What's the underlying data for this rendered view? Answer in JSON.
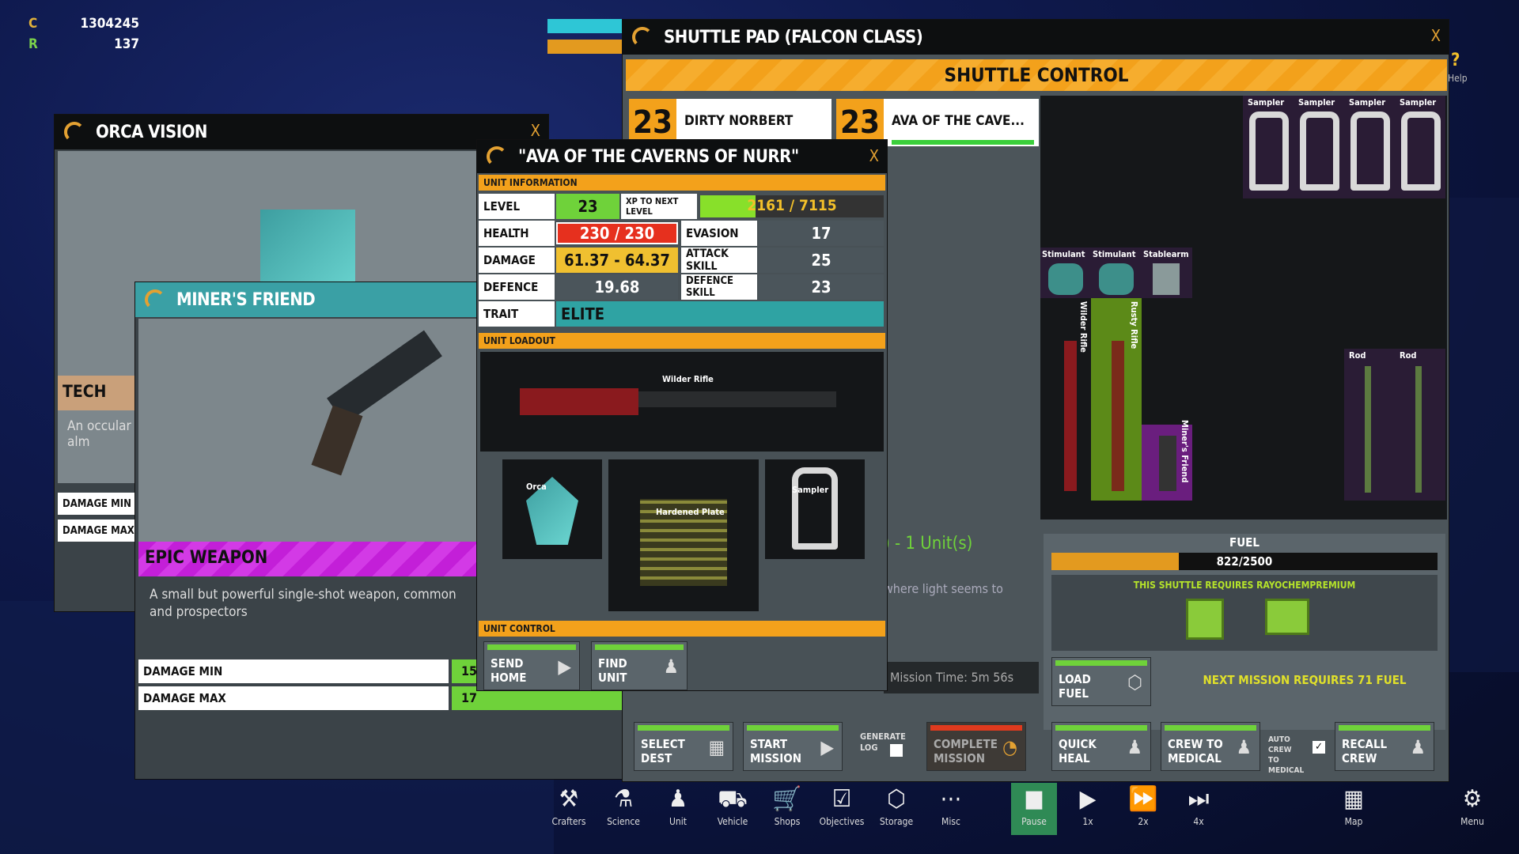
{
  "resources": {
    "c_label": "C",
    "c_value": "1304245",
    "r_label": "R",
    "r_value": "137"
  },
  "orca_vision": {
    "title": "ORCA VISION",
    "close": "X",
    "tech_label": "TECH",
    "desc": "An occular\nalm",
    "rows": [
      "DAMAGE MIN",
      "DAMAGE MAX"
    ]
  },
  "miners_friend": {
    "title": "MINER'S FRIEND",
    "rarity": "EPIC WEAPON",
    "desc": "A small but powerful single-shot weapon, common\nand prospectors",
    "damage_min_label": "DAMAGE MIN",
    "damage_min": "15",
    "damage_max_label": "DAMAGE MAX",
    "damage_max": "17"
  },
  "unit_window": {
    "title": "\"AVA OF THE CAVERNS OF NURR\"",
    "close": "X",
    "info_header": "UNIT INFORMATION",
    "level_label": "LEVEL",
    "level": "23",
    "xp_label": "XP TO NEXT LEVEL",
    "xp": "2161 / 7115",
    "xp_fraction": 0.3,
    "health_label": "HEALTH",
    "health": "230 / 230",
    "evasion_label": "EVASION",
    "evasion": "17",
    "damage_label": "DAMAGE",
    "damage": "61.37 - 64.37",
    "attack_label": "ATTACK SKILL",
    "attack": "25",
    "defence_label": "DEFENCE",
    "defence": "19.68",
    "defence_skill_label": "DEFENCE SKILL",
    "defence_skill": "23",
    "trait_label": "TRAIT",
    "trait": "ELITE",
    "loadout_header": "UNIT LOADOUT",
    "weapon": "Wilder Rifle",
    "slot_orca": "Orca",
    "slot_armor": "Hardened Plate",
    "slot_sampler": "Sampler",
    "control_header": "UNIT CONTROL",
    "send_home": "SEND\nHOME",
    "find_unit": "FIND\nUNIT"
  },
  "shuttle": {
    "title": "SHUTTLE PAD (FALCON CLASS)",
    "close": "X",
    "control_title": "SHUTTLE CONTROL",
    "crew": [
      {
        "level": "23",
        "name": "DIRTY NORBERT"
      },
      {
        "level": "23",
        "name": "AVA OF THE CAVE..."
      }
    ],
    "mission_text": ") - 1 Unit(s)",
    "mission_desc": "where light seems to",
    "mission_time": "Mission Time: 5m 56s",
    "fuel_label": "FUEL",
    "fuel": "822/2500",
    "fuel_fraction": 0.33,
    "requires": "THIS SHUTTLE REQUIRES RAYOCHEMPREMIUM",
    "load_fuel": "LOAD\nFUEL",
    "next_mission": "NEXT MISSION REQUIRES 71 FUEL",
    "select_dest": "SELECT\nDEST",
    "start_mission": "START\nMISSION",
    "generate_log": "GENERATE\nLOG",
    "complete_mission": "COMPLETE\nMISSION",
    "quick_heal": "QUICK\nHEAL",
    "crew_to_medical": "CREW TO\nMEDICAL",
    "auto_crew": "AUTO CREW\nTO MEDICAL",
    "recall_crew": "RECALL\nCREW",
    "inventory": {
      "samplers": [
        "Sampler",
        "Sampler",
        "Sampler",
        "Sampler"
      ],
      "stimulants": [
        "Stimulant",
        "Stimulant",
        "Stablearm"
      ],
      "rifles": [
        "Wilder Rifle",
        "Rusty Rifle",
        "Miner's Friend"
      ],
      "rods": [
        "Rod",
        "Rod"
      ]
    },
    "help": "Help"
  },
  "toolbar": {
    "items": [
      "Crafters",
      "Science",
      "Unit",
      "Vehicle",
      "Shops",
      "Objectives",
      "Storage",
      "Misc",
      "Pause",
      "1x",
      "2x",
      "4x",
      "Map",
      "Menu"
    ]
  },
  "colors": {
    "accent": "#f3a11b",
    "green": "#6fd23a",
    "health": "#e6301e",
    "damage": "#f0c030",
    "teal": "#2fa3a3",
    "epic": "#c31fd8"
  }
}
